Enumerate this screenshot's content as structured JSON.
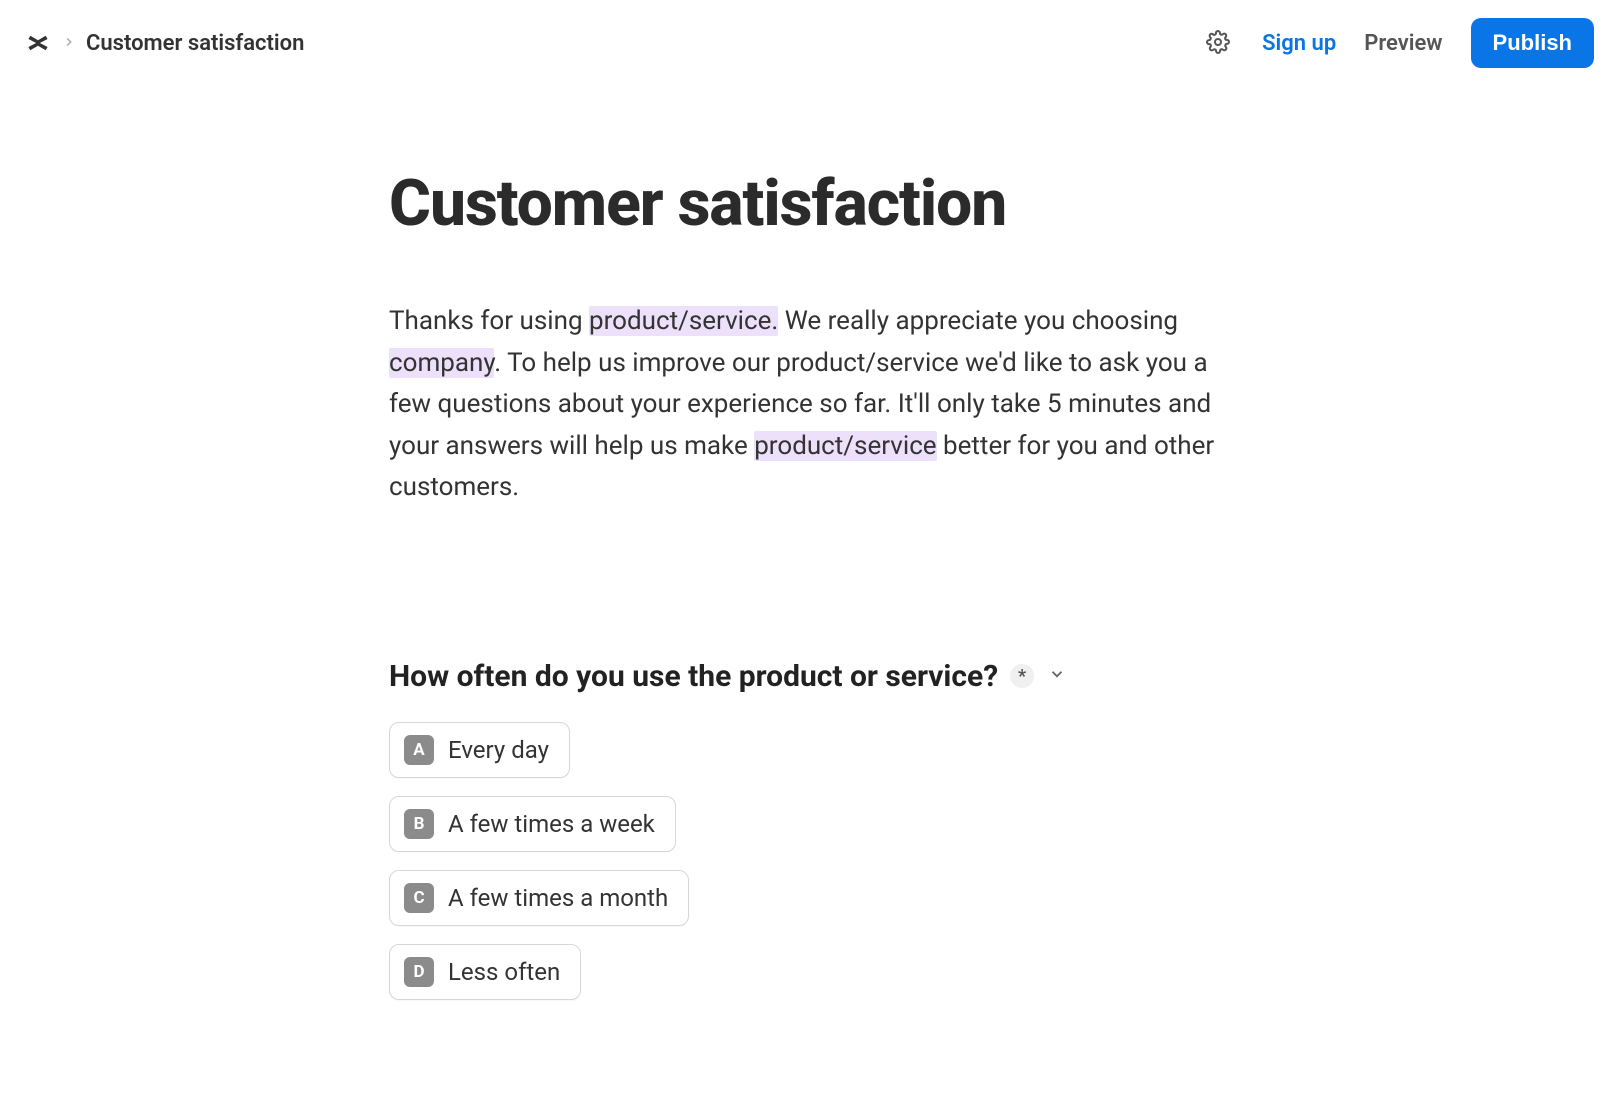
{
  "header": {
    "breadcrumb_title": "Customer satisfaction",
    "signup_label": "Sign up",
    "preview_label": "Preview",
    "publish_label": "Publish"
  },
  "page": {
    "title": "Customer satisfaction",
    "intro": {
      "p1": "Thanks for using ",
      "hl1": "product/service.",
      "p2": " We really appreciate you choosing ",
      "hl2": "company",
      "p3": ". To help us improve our product/service we'd like to ask you a few questions about your experience so far. It'll only take 5 minutes and your answers will help us make ",
      "hl3": "product/service",
      "p4": " better for you and other customers."
    }
  },
  "question": {
    "text": "How often do you use the product or service?",
    "required_symbol": "*",
    "options": [
      {
        "key": "A",
        "label": "Every day"
      },
      {
        "key": "B",
        "label": "A few times a week"
      },
      {
        "key": "C",
        "label": "A few times a month"
      },
      {
        "key": "D",
        "label": "Less often"
      }
    ]
  }
}
